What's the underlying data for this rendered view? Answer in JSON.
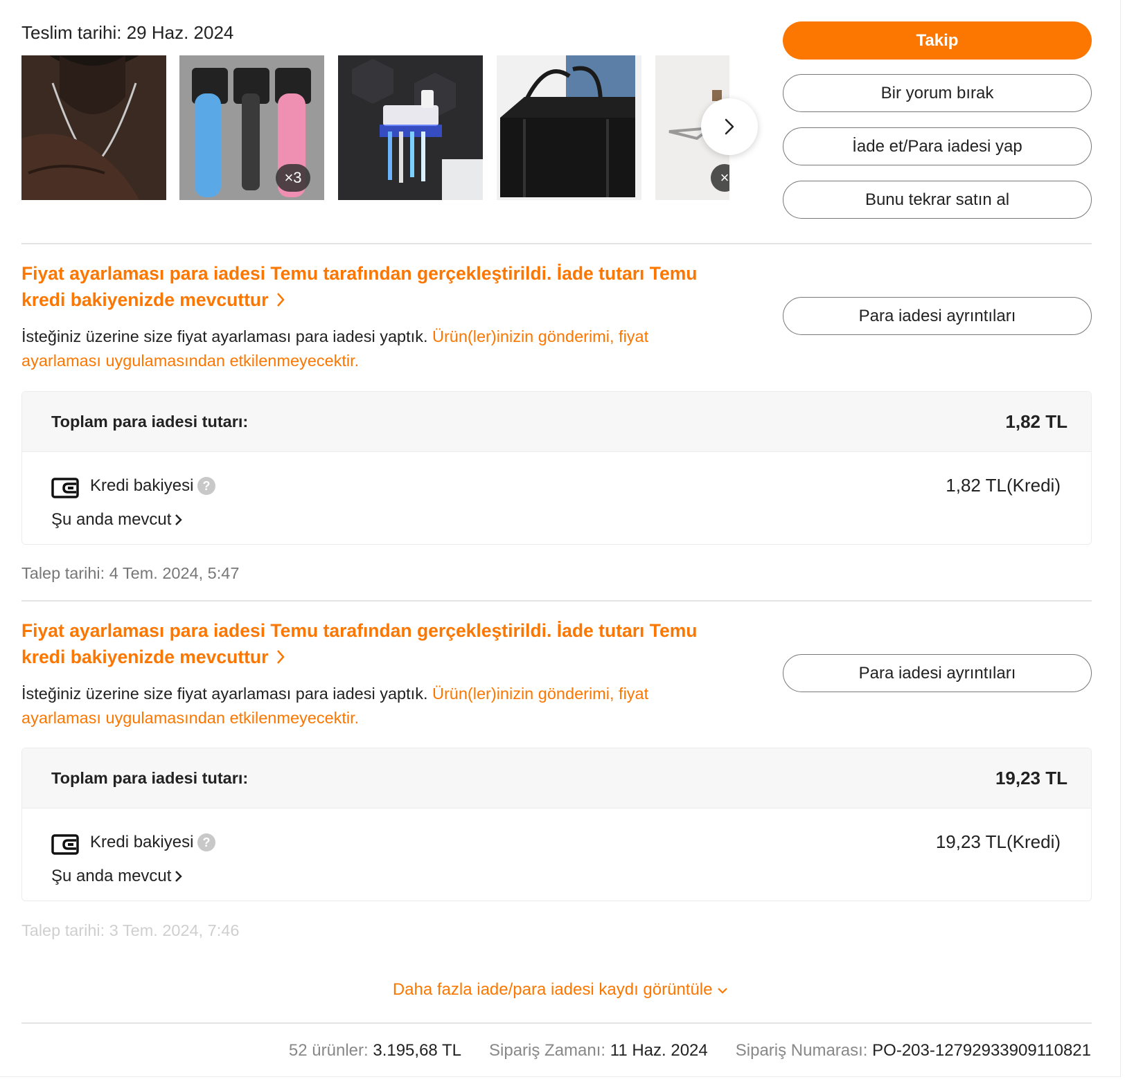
{
  "delivery": {
    "label": "Teslim tarihi:",
    "date": "29 Haz. 2024",
    "text": "Teslim tarihi: 29 Haz. 2024"
  },
  "thumbnails": [
    {
      "name": "necklace-product-image"
    },
    {
      "name": "razor-holder-product-image",
      "qty_badge": "×3"
    },
    {
      "name": "toothbrush-holder-product-image"
    },
    {
      "name": "insulated-bag-product-image"
    },
    {
      "name": "towel-rack-product-image",
      "qty_badge": "×"
    }
  ],
  "actions": {
    "track": "Takip",
    "review": "Bir yorum bırak",
    "return": "İade et/Para iadesi yap",
    "rebuy": "Bunu tekrar satın al"
  },
  "refunds": [
    {
      "title_line1": "Fiyat ayarlaması para iadesi Temu tarafından gerçekleştirildi. İade tutarı Temu",
      "title_line2": "kredi bakiyenizde mevcuttur",
      "desc_plain": "İsteğiniz üzerine size fiyat ayarlaması para iadesi yaptık. ",
      "desc_orange_1": "Ürün(ler)inizin gönderimi, fiyat",
      "desc_orange_2": "ayarlaması uygulamasından etkilenmeyecektir.",
      "details_button": "Para iadesi ayrıntıları",
      "total_label": "Toplam para iadesi tutarı:",
      "total_amount": "1,82 TL",
      "credit_label": "Kredi bakiyesi",
      "credit_amount": "1,82 TL(Kredi)",
      "available_label": "Şu anda mevcut",
      "request_date": "Talep tarihi: 4 Tem. 2024, 5:47"
    },
    {
      "title_line1": "Fiyat ayarlaması para iadesi Temu tarafından gerçekleştirildi. İade tutarı Temu",
      "title_line2": "kredi bakiyenizde mevcuttur",
      "desc_plain": "İsteğiniz üzerine size fiyat ayarlaması para iadesi yaptık. ",
      "desc_orange_1": "Ürün(ler)inizin gönderimi, fiyat",
      "desc_orange_2": "ayarlaması uygulamasından etkilenmeyecektir.",
      "details_button": "Para iadesi ayrıntıları",
      "total_label": "Toplam para iadesi tutarı:",
      "total_amount": "19,23 TL",
      "credit_label": "Kredi bakiyesi",
      "credit_amount": "19,23 TL(Kredi)",
      "available_label": "Şu anda mevcut",
      "request_date": "Talep tarihi: 3 Tem. 2024, 7:46"
    }
  ],
  "more_records_link": "Daha fazla iade/para iadesi kaydı görüntüle",
  "footer": {
    "items_label": "52 ürünler:",
    "items_value": "3.195,68 TL",
    "order_time_label": "Sipariş Zamanı:",
    "order_time_value": "11 Haz. 2024",
    "order_no_label": "Sipariş Numarası:",
    "order_no_value": "PO-203-12792933909110821"
  },
  "colors": {
    "accent": "#fb7701",
    "text": "#222222",
    "muted": "#888888",
    "box_bg": "#f7f7f7"
  },
  "icons": [
    "chevron-right-icon",
    "wallet-icon",
    "help-icon",
    "chevron-down-icon"
  ]
}
